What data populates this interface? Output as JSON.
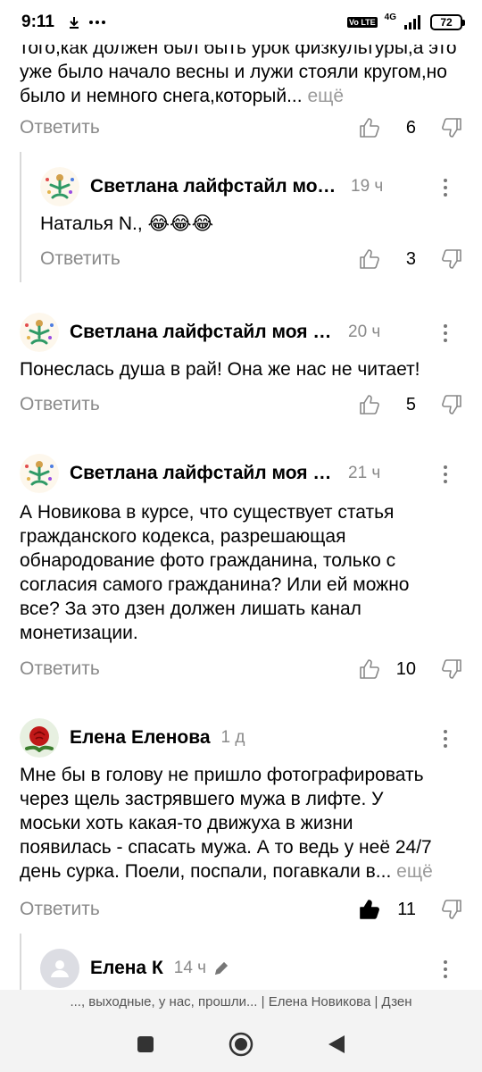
{
  "status_bar": {
    "time": "9:11",
    "volte": "Vo LTE",
    "network": "4G",
    "battery": "72"
  },
  "comments": [
    {
      "text": "того,как должен был быть урок физкультуры,а это уже было начало весны и лужи стояли кругом,но было и немного снега,который...",
      "more": "ещё",
      "reply_label": "Ответить",
      "likes": "6"
    },
    {
      "author": "Светлана лайфстайл моя...",
      "time": "19 ч",
      "text": "Наталья N., 😂😂😂",
      "reply_label": "Ответить",
      "likes": "3"
    },
    {
      "author": "Светлана лайфстайл моя ж...",
      "time": "20 ч",
      "text": "Понеслась душа в рай! Она же нас не читает!",
      "reply_label": "Ответить",
      "likes": "5"
    },
    {
      "author": "Светлана лайфстайл моя ж...",
      "time": "21 ч",
      "text": "А Новикова в курсе, что существует статья гражданского кодекса, разрешающая обнародование фото гражданина, только с согласия самого гражданина? Или ей можно все? За это дзен должен лишать канал монетизации.",
      "reply_label": "Ответить",
      "likes": "10"
    },
    {
      "author": "Елена Еленова",
      "time": "1 д",
      "text": "Мне бы в голову не пришло фотографировать через щель застрявшего мужа в лифте. У моськи хоть какая-то движуха в жизни появилась - спасать мужа. А то ведь у неё 24/7 день сурка. Поели, поспали, погавкали в...",
      "more": "ещё",
      "reply_label": "Ответить",
      "likes": "11"
    },
    {
      "author": "Елена К",
      "time": "14 ч"
    }
  ],
  "source_bar": "..., выходные, у нас, прошли... | Елена Новикова | Дзен"
}
